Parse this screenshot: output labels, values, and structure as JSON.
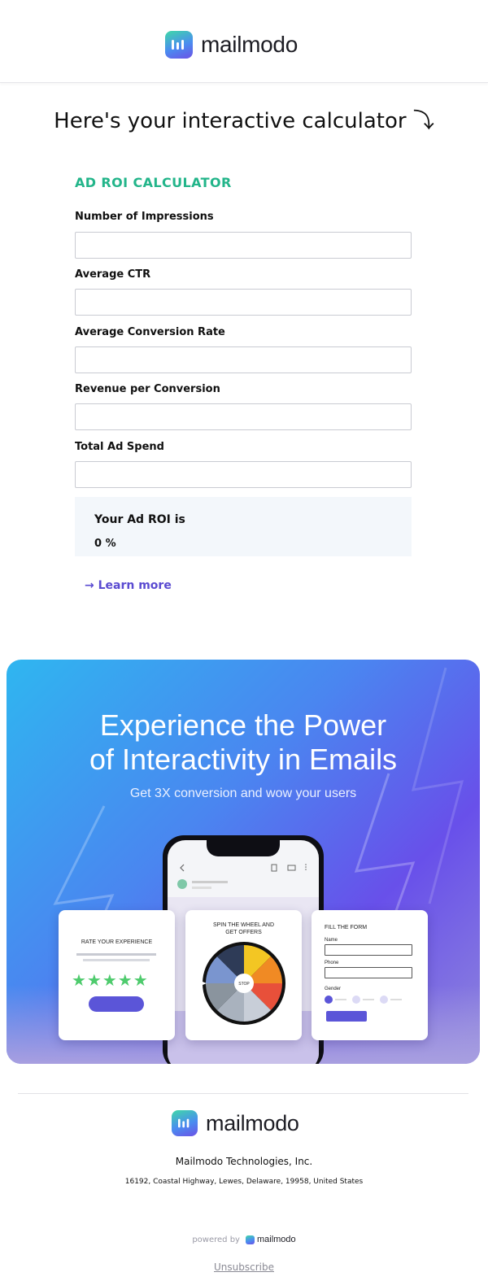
{
  "header": {
    "brand": "mailmodo"
  },
  "page_title": "Here's your interactive calculator ⤵",
  "calculator": {
    "title": "AD ROI CALCULATOR",
    "fields": [
      {
        "label": "Number of Impressions",
        "value": "",
        "placeholder": ""
      },
      {
        "label": "Average CTR",
        "value": "",
        "placeholder": ""
      },
      {
        "label": "Average Conversion Rate",
        "value": "",
        "placeholder": ""
      },
      {
        "label": "Revenue per Conversion",
        "value": "",
        "placeholder": ""
      },
      {
        "label": "Total Ad Spend",
        "value": "",
        "placeholder": ""
      }
    ],
    "result_label": "Your Ad ROI is",
    "result_value": "0 %",
    "learn_more": "→ Learn more"
  },
  "banner": {
    "title_line1": "Experience the Power",
    "title_line2": "of Interactivity in Emails",
    "subtitle": "Get 3X conversion and wow your users",
    "card_rate": {
      "title": "RATE YOUR EXPERIENCE",
      "stars": "★★★★★"
    },
    "card_spin": {
      "title_line1": "SPIN THE WHEEL AND",
      "title_line2": "GET OFFERS",
      "center": "STOP"
    },
    "card_form": {
      "title": "FILL THE FORM",
      "name_label": "Name",
      "phone_label": "Phone",
      "gender_label": "Gender"
    }
  },
  "footer": {
    "brand": "mailmodo",
    "company": "Mailmodo Technologies, Inc.",
    "address": "16192, Coastal Highway, Lewes, Delaware, 19958, United States",
    "powered_by": "powered by",
    "powered_brand": "mailmodo",
    "unsubscribe": "Unsubscribe"
  },
  "colors": {
    "accent_green": "#23b58a",
    "link_purple": "#5a4bd1",
    "star_green": "#4ecb6d"
  }
}
